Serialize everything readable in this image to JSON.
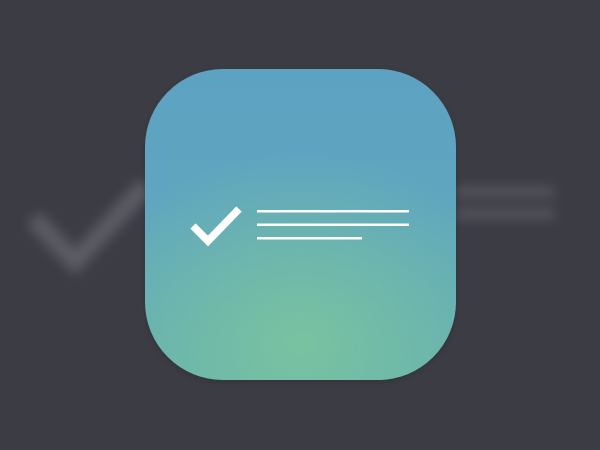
{
  "colors": {
    "background": "#3c3c44",
    "icon_top": "#5ea2c2",
    "icon_bottom_glow": "#79c2a0",
    "glyph": "#ffffff"
  },
  "icons": {
    "main": "checklist-app-icon",
    "check": "checkmark-icon",
    "lines": "text-lines-icon"
  }
}
